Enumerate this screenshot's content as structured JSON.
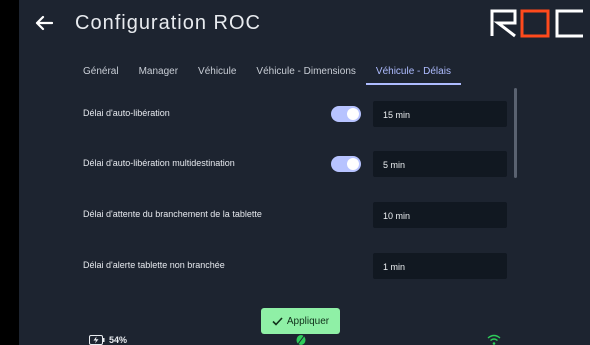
{
  "header": {
    "title": "Configuration ROC",
    "logo_text": "ROC",
    "back_icon": "arrow-left-icon"
  },
  "tabs": [
    {
      "label": "Général",
      "active": false
    },
    {
      "label": "Manager",
      "active": false
    },
    {
      "label": "Véhicule",
      "active": false
    },
    {
      "label": "Véhicule - Dimensions",
      "active": false
    },
    {
      "label": "Véhicule - Délais",
      "active": true
    }
  ],
  "settings": [
    {
      "label": "Délai d'auto-libération",
      "toggle": true,
      "toggle_on": true,
      "value": "15 min"
    },
    {
      "label": "Délai d'auto-libération multidestination",
      "toggle": true,
      "toggle_on": true,
      "value": "5 min"
    },
    {
      "label": "Délai d'attente du branchement de la tablette",
      "toggle": false,
      "value": "10 min"
    },
    {
      "label": "Délai d'alerte tablette non branchée",
      "toggle": false,
      "value": "1 min"
    }
  ],
  "actions": {
    "apply_label": "Appliquer",
    "apply_icon": "checkmark-icon"
  },
  "status_bar": {
    "battery_percent": "54%",
    "battery_icon": "battery-charging-icon",
    "leaf_icon": "leaf-icon",
    "wifi_icon": "wifi-icon"
  },
  "colors": {
    "background": "#1d2430",
    "accent": "#aebcff",
    "toggle_on": "#b7c3ff",
    "apply_button": "#8ff0a6",
    "logo_accent": "#ff4a1c",
    "status_green": "#2ecc5a"
  }
}
